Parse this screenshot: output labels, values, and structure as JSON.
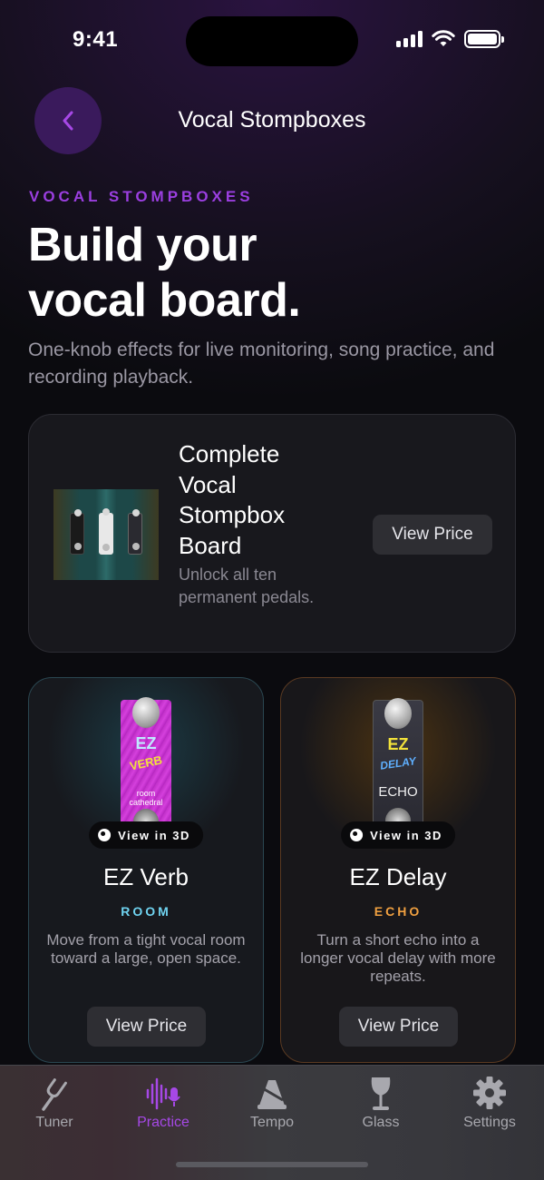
{
  "status": {
    "time": "9:41",
    "icons": [
      "signal-icon",
      "wifi-icon",
      "battery-icon"
    ]
  },
  "nav": {
    "back_icon": "chevron-left-icon",
    "title": "Vocal Stompboxes"
  },
  "hero": {
    "eyebrow": "VOCAL STOMPBOXES",
    "headline_line1": "Build your",
    "headline_line2": "vocal board.",
    "subtitle": "One-knob effects for live monitoring, song practice, and recording playback."
  },
  "bundle": {
    "title": "Complete Vocal Stompbox Board",
    "description": "Unlock all ten permanent pedals.",
    "button_label": "View Price"
  },
  "pedals": [
    {
      "name": "EZ Verb",
      "type": "ROOM",
      "type_color": "#6fd3f0",
      "description": "Move from a tight vocal room toward a large, open space.",
      "button_label": "View Price",
      "view3d_label": "View in 3D",
      "art_text_top": "EZ",
      "art_text_mid": "VERB",
      "art_text_low": "room cathedral"
    },
    {
      "name": "EZ Delay",
      "type": "ECHO",
      "type_color": "#f0a040",
      "description": "Turn a short echo into a longer vocal delay with more repeats.",
      "button_label": "View Price",
      "view3d_label": "View in 3D",
      "art_text_top": "EZ",
      "art_text_mid": "DELAY",
      "art_text_low": "ECHO"
    }
  ],
  "tabs": [
    {
      "label": "Tuner",
      "icon": "tuning-fork-icon",
      "active": false
    },
    {
      "label": "Practice",
      "icon": "waveform-mic-icon",
      "active": true
    },
    {
      "label": "Tempo",
      "icon": "metronome-icon",
      "active": false
    },
    {
      "label": "Glass",
      "icon": "wine-glass-icon",
      "active": false
    },
    {
      "label": "Settings",
      "icon": "gear-icon",
      "active": false
    }
  ],
  "colors": {
    "accent": "#9b3fe0",
    "tab_active": "#a648e6",
    "back_button_bg": "#3a1a5c"
  }
}
